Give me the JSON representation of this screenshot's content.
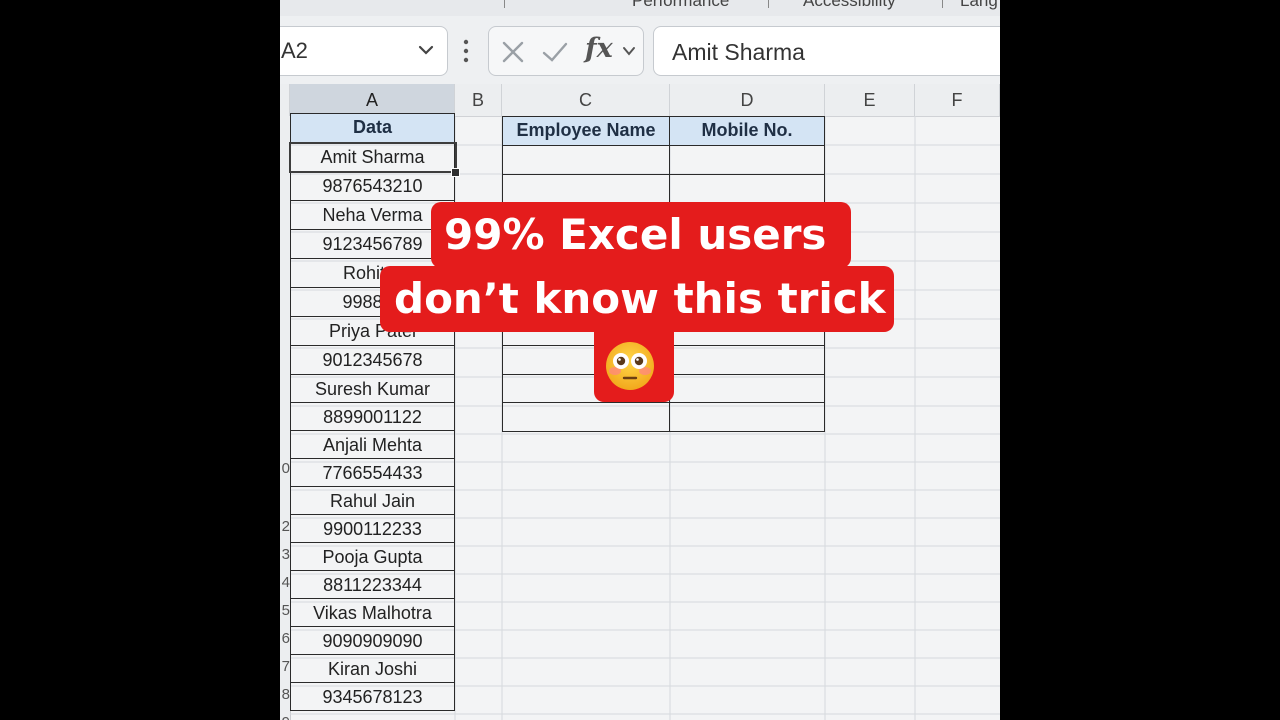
{
  "ribbon_tabs": [
    "Performance",
    "Accessibility",
    "Lang"
  ],
  "name_box": {
    "value": "A2"
  },
  "formula_bar": {
    "fx_label": "fx",
    "value": "Amit Sharma"
  },
  "columns": [
    "A",
    "B",
    "C",
    "D",
    "E",
    "F"
  ],
  "selected_column": "A",
  "row_number_fragments": [
    "2",
    "3",
    "4",
    "5",
    "6",
    "7",
    "8",
    "9",
    "0"
  ],
  "data_column": {
    "header": "Data",
    "values": [
      "Amit Sharma",
      "9876543210",
      "Neha Verma",
      "9123456789",
      "Rohit S",
      "998877",
      "Priya Patel",
      "9012345678",
      "Suresh Kumar",
      "8899001122",
      "Anjali Mehta",
      "7766554433",
      "Rahul Jain",
      "9900112233",
      "Pooja Gupta",
      "8811223344",
      "Vikas Malhotra",
      "9090909090",
      "Kiran Joshi",
      "9345678123"
    ]
  },
  "target_table": {
    "headers": [
      "Employee Name",
      "Mobile No."
    ]
  },
  "overlay": {
    "line1": "99% Excel users",
    "line2": "don’t know this trick",
    "emoji": "flushed-face-emoji"
  },
  "colors": {
    "caption_red": "#e41c1c",
    "header_fill": "#d4e4f4",
    "selected_col_accent": "#2e7d4f"
  }
}
